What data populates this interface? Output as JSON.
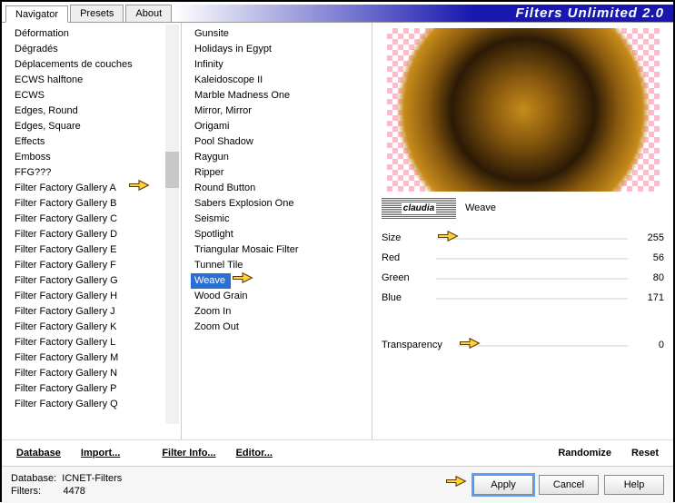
{
  "title": "Filters Unlimited 2.0",
  "tabs": [
    "Navigator",
    "Presets",
    "About"
  ],
  "list1": [
    "Déformation",
    "Dégradés",
    "Déplacements de couches",
    "ECWS halftone",
    "ECWS",
    "Edges, Round",
    "Edges, Square",
    "Effects",
    "Emboss",
    "FFG???",
    "Filter Factory Gallery A",
    "Filter Factory Gallery B",
    "Filter Factory Gallery C",
    "Filter Factory Gallery D",
    "Filter Factory Gallery E",
    "Filter Factory Gallery F",
    "Filter Factory Gallery G",
    "Filter Factory Gallery H",
    "Filter Factory Gallery J",
    "Filter Factory Gallery K",
    "Filter Factory Gallery L",
    "Filter Factory Gallery M",
    "Filter Factory Gallery N",
    "Filter Factory Gallery P",
    "Filter Factory Gallery Q"
  ],
  "list2": [
    "Gunsite",
    "Holidays in Egypt",
    "Infinity",
    "Kaleidoscope II",
    "Marble Madness One",
    "Mirror, Mirror",
    "Origami",
    "Pool Shadow",
    "Raygun",
    "Ripper",
    "Round Button",
    "Sabers Explosion One",
    "Seismic",
    "Spotlight",
    "Triangular Mosaic Filter",
    "Tunnel Tile",
    "Weave",
    "Wood Grain",
    "Zoom In",
    "Zoom Out"
  ],
  "selected_filter": "Weave",
  "logo_text": "claudia",
  "params": {
    "size": {
      "label": "Size",
      "value": 255
    },
    "red": {
      "label": "Red",
      "value": 56
    },
    "green": {
      "label": "Green",
      "value": 80
    },
    "blue": {
      "label": "Blue",
      "value": 171
    },
    "transparency": {
      "label": "Transparency",
      "value": 0
    }
  },
  "buttons": {
    "database": "Database",
    "import": "Import...",
    "filterinfo": "Filter Info...",
    "editor": "Editor...",
    "randomize": "Randomize",
    "reset": "Reset",
    "apply": "Apply",
    "cancel": "Cancel",
    "help": "Help"
  },
  "footer": {
    "db_label": "Database:",
    "db_value": "ICNET-Filters",
    "filters_label": "Filters:",
    "filters_value": "4478"
  }
}
